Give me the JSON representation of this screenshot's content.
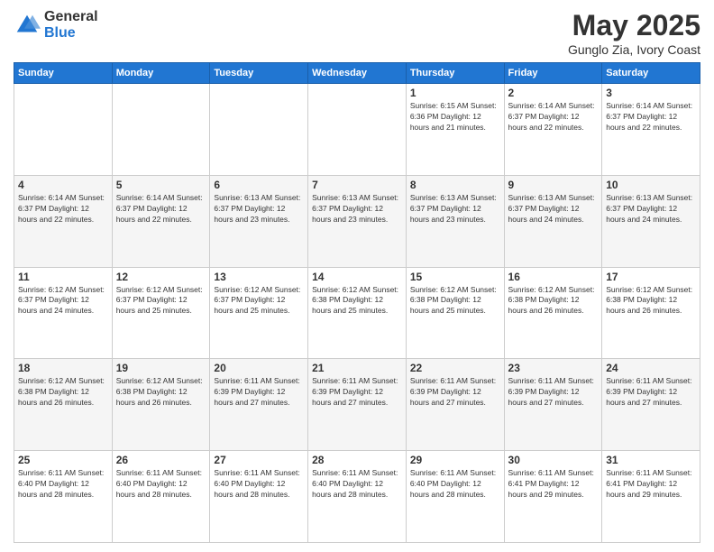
{
  "logo": {
    "general": "General",
    "blue": "Blue"
  },
  "header": {
    "title": "May 2025",
    "subtitle": "Gunglo Zia, Ivory Coast"
  },
  "weekdays": [
    "Sunday",
    "Monday",
    "Tuesday",
    "Wednesday",
    "Thursday",
    "Friday",
    "Saturday"
  ],
  "weeks": [
    [
      {
        "day": "",
        "info": ""
      },
      {
        "day": "",
        "info": ""
      },
      {
        "day": "",
        "info": ""
      },
      {
        "day": "",
        "info": ""
      },
      {
        "day": "1",
        "info": "Sunrise: 6:15 AM\nSunset: 6:36 PM\nDaylight: 12 hours\nand 21 minutes."
      },
      {
        "day": "2",
        "info": "Sunrise: 6:14 AM\nSunset: 6:37 PM\nDaylight: 12 hours\nand 22 minutes."
      },
      {
        "day": "3",
        "info": "Sunrise: 6:14 AM\nSunset: 6:37 PM\nDaylight: 12 hours\nand 22 minutes."
      }
    ],
    [
      {
        "day": "4",
        "info": "Sunrise: 6:14 AM\nSunset: 6:37 PM\nDaylight: 12 hours\nand 22 minutes."
      },
      {
        "day": "5",
        "info": "Sunrise: 6:14 AM\nSunset: 6:37 PM\nDaylight: 12 hours\nand 22 minutes."
      },
      {
        "day": "6",
        "info": "Sunrise: 6:13 AM\nSunset: 6:37 PM\nDaylight: 12 hours\nand 23 minutes."
      },
      {
        "day": "7",
        "info": "Sunrise: 6:13 AM\nSunset: 6:37 PM\nDaylight: 12 hours\nand 23 minutes."
      },
      {
        "day": "8",
        "info": "Sunrise: 6:13 AM\nSunset: 6:37 PM\nDaylight: 12 hours\nand 23 minutes."
      },
      {
        "day": "9",
        "info": "Sunrise: 6:13 AM\nSunset: 6:37 PM\nDaylight: 12 hours\nand 24 minutes."
      },
      {
        "day": "10",
        "info": "Sunrise: 6:13 AM\nSunset: 6:37 PM\nDaylight: 12 hours\nand 24 minutes."
      }
    ],
    [
      {
        "day": "11",
        "info": "Sunrise: 6:12 AM\nSunset: 6:37 PM\nDaylight: 12 hours\nand 24 minutes."
      },
      {
        "day": "12",
        "info": "Sunrise: 6:12 AM\nSunset: 6:37 PM\nDaylight: 12 hours\nand 25 minutes."
      },
      {
        "day": "13",
        "info": "Sunrise: 6:12 AM\nSunset: 6:37 PM\nDaylight: 12 hours\nand 25 minutes."
      },
      {
        "day": "14",
        "info": "Sunrise: 6:12 AM\nSunset: 6:38 PM\nDaylight: 12 hours\nand 25 minutes."
      },
      {
        "day": "15",
        "info": "Sunrise: 6:12 AM\nSunset: 6:38 PM\nDaylight: 12 hours\nand 25 minutes."
      },
      {
        "day": "16",
        "info": "Sunrise: 6:12 AM\nSunset: 6:38 PM\nDaylight: 12 hours\nand 26 minutes."
      },
      {
        "day": "17",
        "info": "Sunrise: 6:12 AM\nSunset: 6:38 PM\nDaylight: 12 hours\nand 26 minutes."
      }
    ],
    [
      {
        "day": "18",
        "info": "Sunrise: 6:12 AM\nSunset: 6:38 PM\nDaylight: 12 hours\nand 26 minutes."
      },
      {
        "day": "19",
        "info": "Sunrise: 6:12 AM\nSunset: 6:38 PM\nDaylight: 12 hours\nand 26 minutes."
      },
      {
        "day": "20",
        "info": "Sunrise: 6:11 AM\nSunset: 6:39 PM\nDaylight: 12 hours\nand 27 minutes."
      },
      {
        "day": "21",
        "info": "Sunrise: 6:11 AM\nSunset: 6:39 PM\nDaylight: 12 hours\nand 27 minutes."
      },
      {
        "day": "22",
        "info": "Sunrise: 6:11 AM\nSunset: 6:39 PM\nDaylight: 12 hours\nand 27 minutes."
      },
      {
        "day": "23",
        "info": "Sunrise: 6:11 AM\nSunset: 6:39 PM\nDaylight: 12 hours\nand 27 minutes."
      },
      {
        "day": "24",
        "info": "Sunrise: 6:11 AM\nSunset: 6:39 PM\nDaylight: 12 hours\nand 27 minutes."
      }
    ],
    [
      {
        "day": "25",
        "info": "Sunrise: 6:11 AM\nSunset: 6:40 PM\nDaylight: 12 hours\nand 28 minutes."
      },
      {
        "day": "26",
        "info": "Sunrise: 6:11 AM\nSunset: 6:40 PM\nDaylight: 12 hours\nand 28 minutes."
      },
      {
        "day": "27",
        "info": "Sunrise: 6:11 AM\nSunset: 6:40 PM\nDaylight: 12 hours\nand 28 minutes."
      },
      {
        "day": "28",
        "info": "Sunrise: 6:11 AM\nSunset: 6:40 PM\nDaylight: 12 hours\nand 28 minutes."
      },
      {
        "day": "29",
        "info": "Sunrise: 6:11 AM\nSunset: 6:40 PM\nDaylight: 12 hours\nand 28 minutes."
      },
      {
        "day": "30",
        "info": "Sunrise: 6:11 AM\nSunset: 6:41 PM\nDaylight: 12 hours\nand 29 minutes."
      },
      {
        "day": "31",
        "info": "Sunrise: 6:11 AM\nSunset: 6:41 PM\nDaylight: 12 hours\nand 29 minutes."
      }
    ]
  ]
}
